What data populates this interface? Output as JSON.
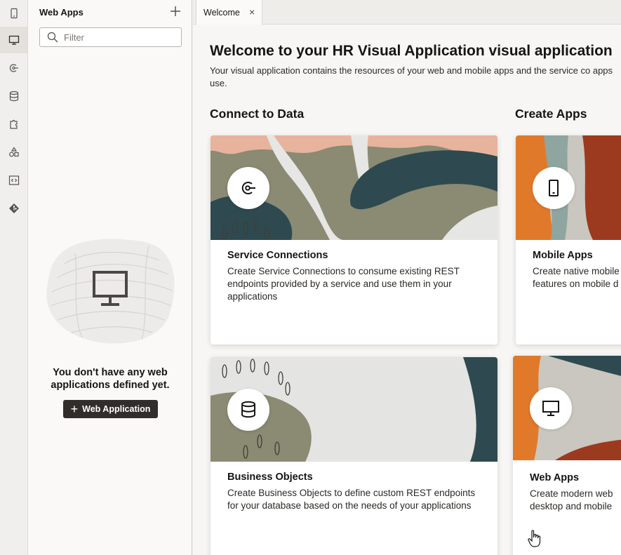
{
  "rail": {
    "items": [
      {
        "icon": "mobile-icon",
        "active": false
      },
      {
        "icon": "desktop-icon",
        "active": true
      },
      {
        "icon": "service-connection-icon",
        "active": false
      },
      {
        "icon": "database-icon",
        "active": false
      },
      {
        "icon": "puzzle-icon",
        "active": false
      },
      {
        "icon": "shapes-icon",
        "active": false
      },
      {
        "icon": "code-icon",
        "active": false
      },
      {
        "icon": "git-icon",
        "active": false
      }
    ]
  },
  "panel": {
    "title": "Web Apps",
    "filter_placeholder": "Filter",
    "empty_message": "You don't have any web applications defined yet.",
    "add_button_label": "Web Application"
  },
  "tabs": [
    {
      "label": "Welcome",
      "close": "×"
    }
  ],
  "welcome": {
    "title": "Welcome to your HR Visual Application visual application",
    "description": "Your visual application contains the resources of your web and mobile apps and the service co apps use."
  },
  "sections": {
    "connect": "Connect to Data",
    "create": "Create Apps"
  },
  "cards": {
    "service_connections": {
      "title": "Service Connections",
      "description": "Create Service Connections to consume existing REST endpoints provided by a service and use them in your applications"
    },
    "mobile_apps": {
      "title": "Mobile Apps",
      "description": "Create native mobile features on mobile d"
    },
    "business_objects": {
      "title": "Business Objects",
      "description": "Create Business Objects to define custom REST endpoints for your database based on the needs of your applications"
    },
    "web_apps": {
      "title": "Web Apps",
      "description": "Create modern web desktop and mobile"
    }
  },
  "colors": {
    "accent_dark": "#312d2a",
    "art_green": "#8b8a73",
    "art_teal": "#2e4a50",
    "art_peach": "#e8b39c",
    "art_orange": "#e07a2a",
    "art_rust": "#9c3a1f"
  }
}
